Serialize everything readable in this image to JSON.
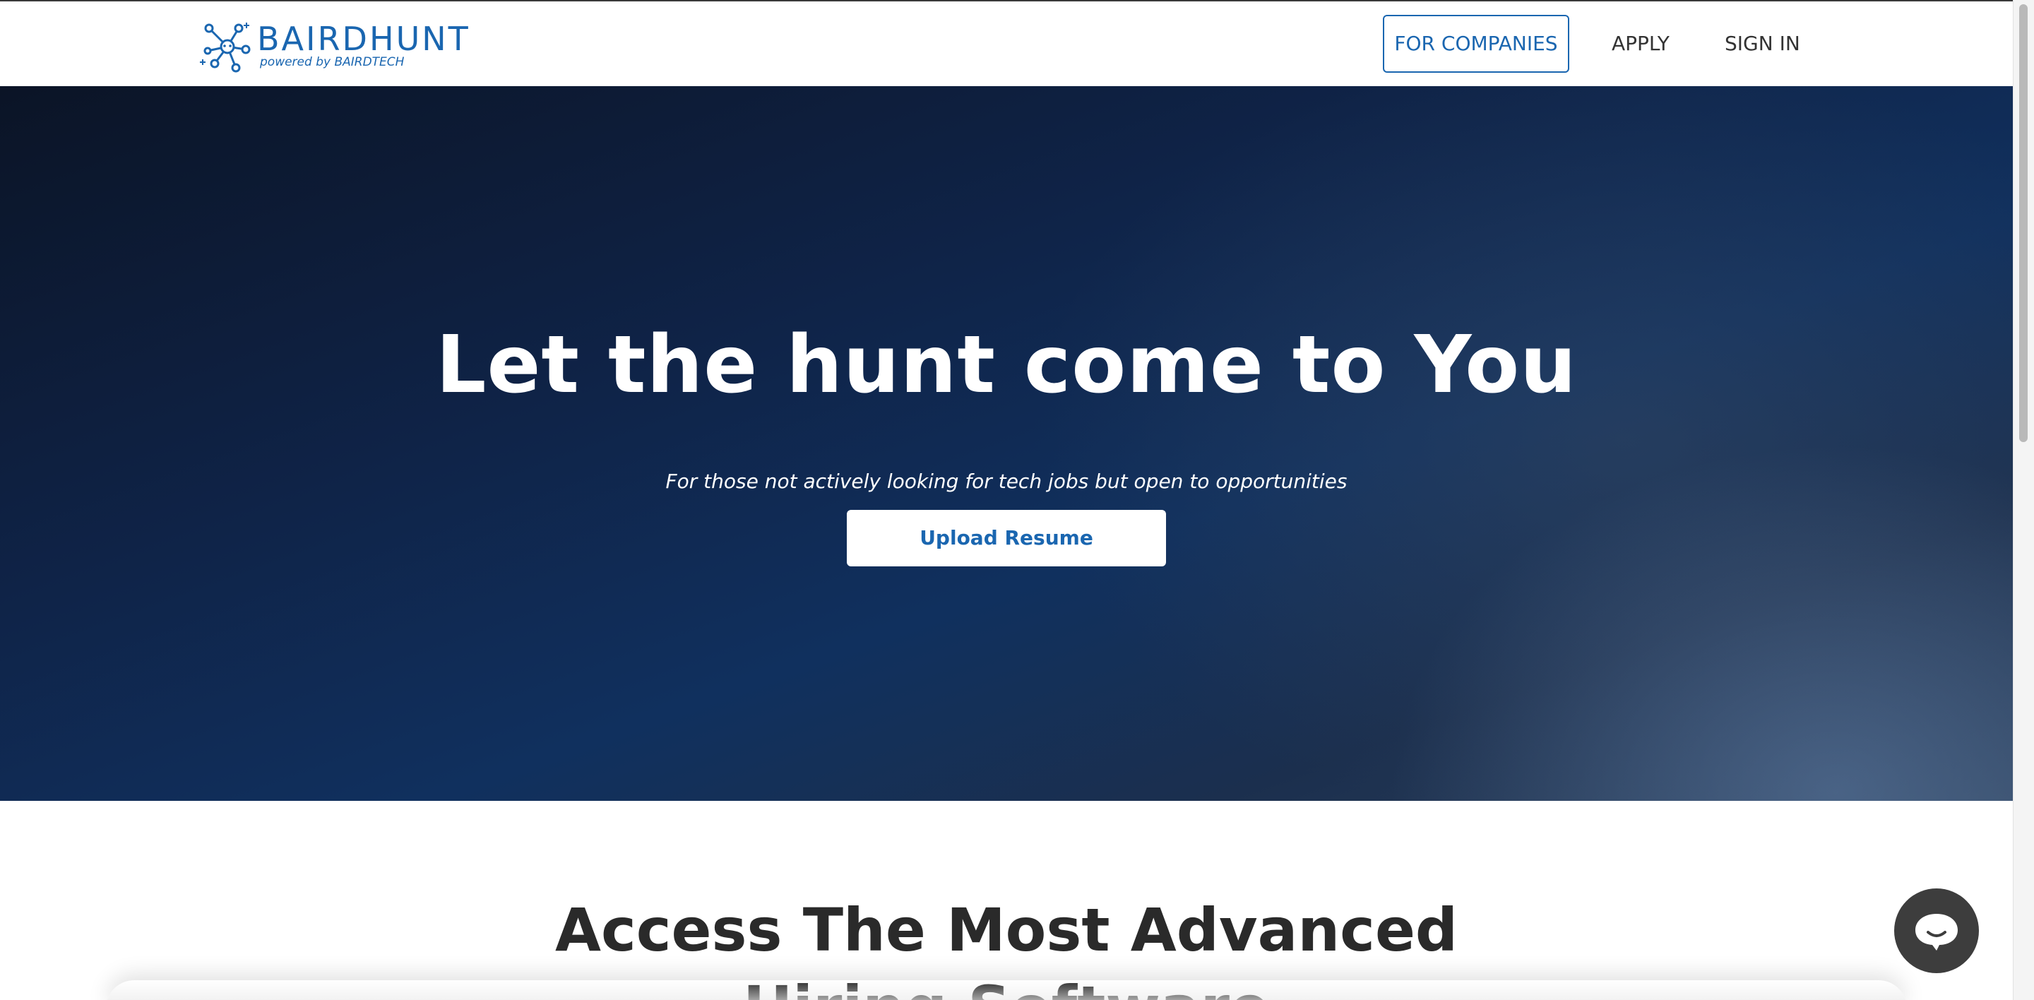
{
  "header": {
    "logo": {
      "wordmark": "BAIRDHUNT",
      "tagline": "powered by BAIRDTECH",
      "icon": "network-molecule-icon"
    },
    "nav": {
      "for_companies": "FOR COMPANIES",
      "apply": "APPLY",
      "sign_in": "SIGN IN"
    }
  },
  "hero": {
    "title": "Let the hunt come to You",
    "subtitle": "For those not actively looking for tech jobs but open to opportunities",
    "cta_label": "Upload Resume"
  },
  "section": {
    "title_line1": "Access The Most Advanced",
    "title_line2": "Hiring Software"
  },
  "chat": {
    "icon": "chat-bubble-icon"
  },
  "colors": {
    "brand_blue": "#1a66b0",
    "hero_dark": "#0f2347",
    "text_dark": "#2a2a2a",
    "chat_bg": "#3d3d3d"
  }
}
